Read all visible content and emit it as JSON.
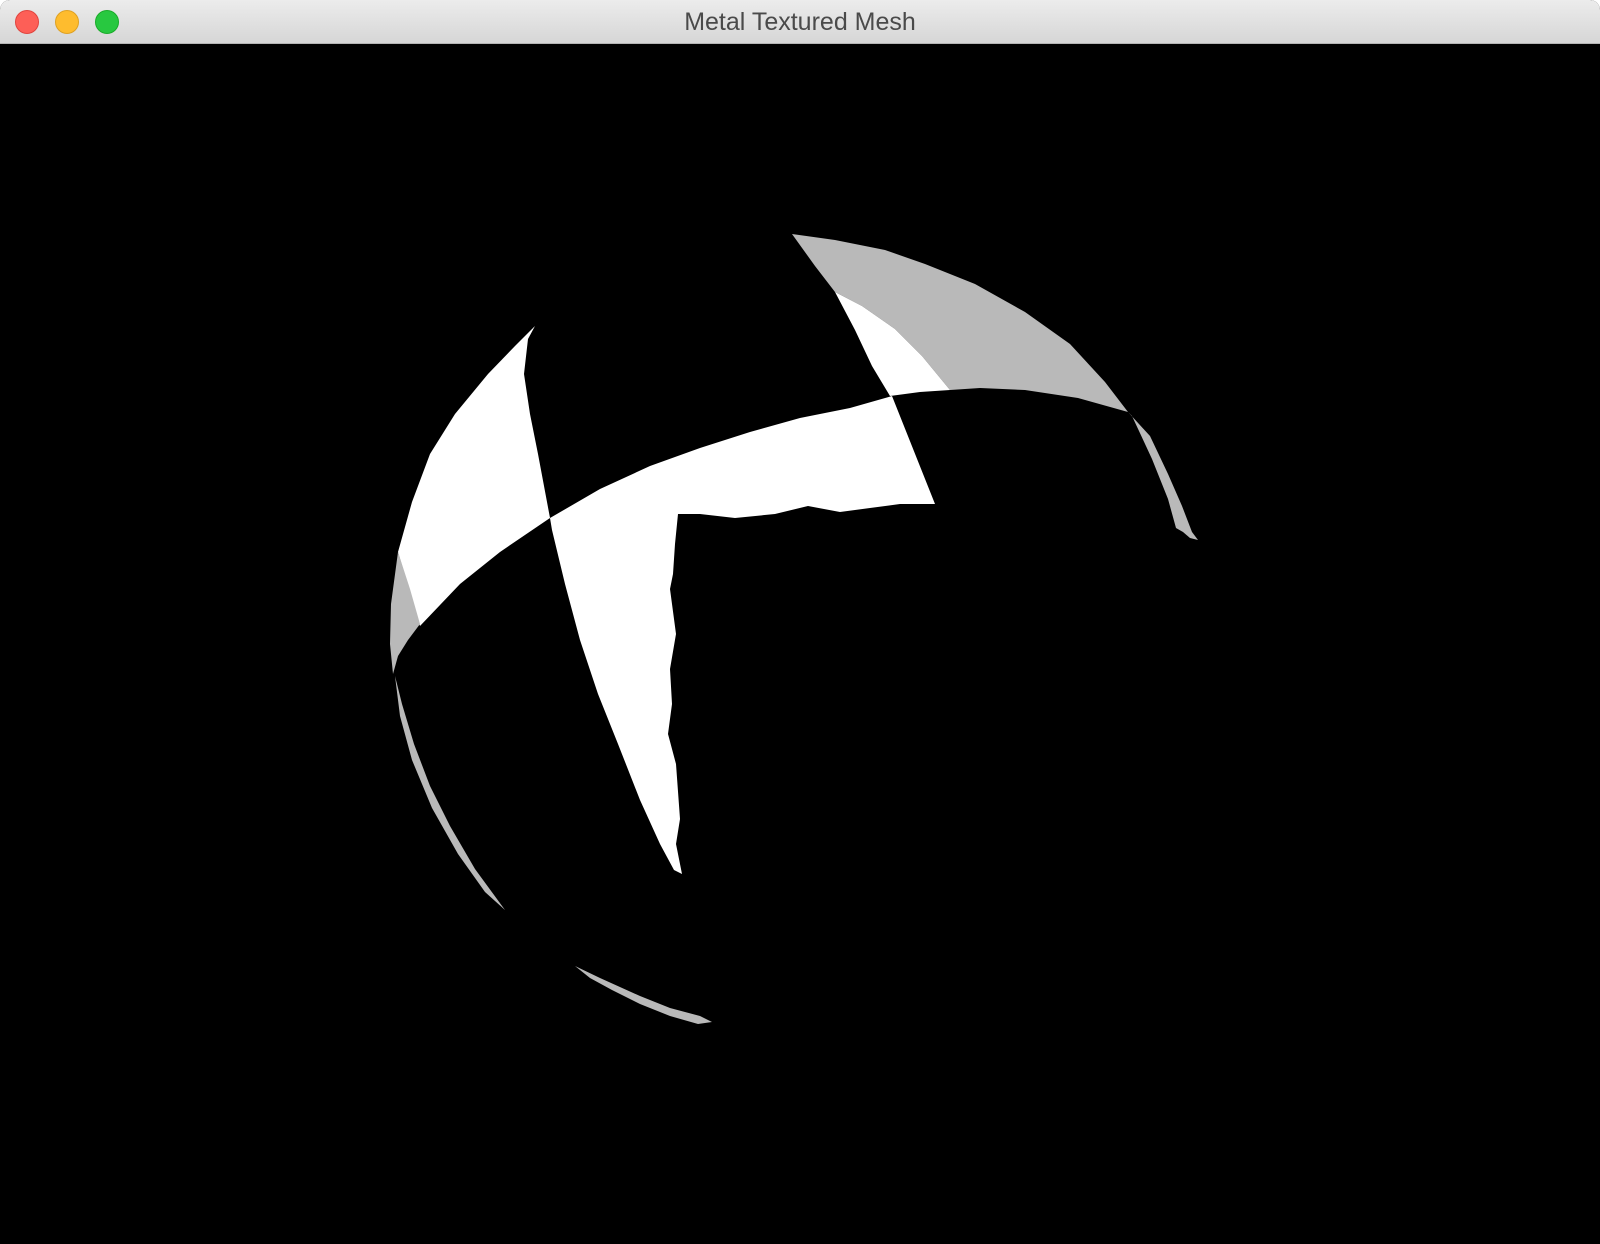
{
  "window": {
    "title": "Metal Textured Mesh"
  },
  "colors": {
    "titlebar": "#e2e2e2",
    "close": "#fd5f57",
    "minimize": "#febc2e",
    "zoom": "#28c840",
    "canvas_background": "#000000",
    "mesh_white": "#ffffff",
    "mesh_gray": "#b8b8b8"
  },
  "icons": {
    "close": "close-icon",
    "minimize": "minimize-icon",
    "zoom": "zoom-icon"
  }
}
